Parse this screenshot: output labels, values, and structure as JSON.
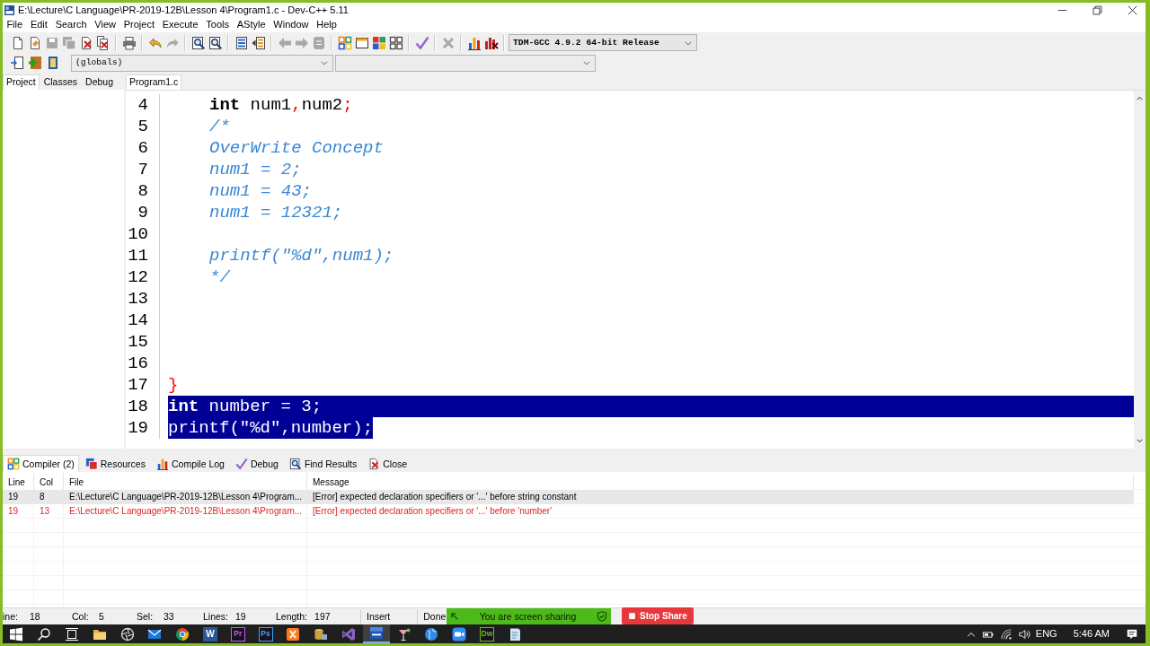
{
  "window": {
    "title": "E:\\Lecture\\C Language\\PR-2019-12B\\Lesson 4\\Program1.c - Dev-C++ 5.11"
  },
  "menu": [
    "File",
    "Edit",
    "Search",
    "View",
    "Project",
    "Execute",
    "Tools",
    "AStyle",
    "Window",
    "Help"
  ],
  "toolbar": {
    "groups": [
      [
        {
          "kind": "new",
          "disabled": false
        },
        {
          "kind": "open",
          "disabled": false
        },
        {
          "kind": "save",
          "disabled": true
        },
        {
          "kind": "saveall",
          "disabled": true
        },
        {
          "kind": "close",
          "disabled": false
        },
        {
          "kind": "closeall",
          "disabled": false
        }
      ],
      [
        {
          "kind": "print",
          "disabled": false
        }
      ],
      [
        {
          "kind": "undo",
          "disabled": false
        },
        {
          "kind": "redo",
          "disabled": true
        }
      ],
      [
        {
          "kind": "find",
          "disabled": false
        },
        {
          "kind": "replace",
          "disabled": false
        }
      ],
      [
        {
          "kind": "indent",
          "disabled": false
        },
        {
          "kind": "unindent",
          "disabled": false
        }
      ],
      [
        {
          "kind": "back",
          "disabled": true
        },
        {
          "kind": "forward",
          "disabled": true
        },
        {
          "kind": "bookmark",
          "disabled": true
        }
      ],
      [
        {
          "kind": "compile",
          "disabled": false
        },
        {
          "kind": "run",
          "disabled": false
        },
        {
          "kind": "compilerun",
          "disabled": false
        },
        {
          "kind": "rebuild",
          "disabled": false
        }
      ],
      [
        {
          "kind": "check",
          "disabled": false
        }
      ],
      [
        {
          "kind": "stop",
          "disabled": true
        }
      ],
      [
        {
          "kind": "profile",
          "disabled": false
        },
        {
          "kind": "deleteprofile",
          "disabled": false
        }
      ]
    ],
    "compiler": "TDM-GCC 4.9.2 64-bit Release"
  },
  "class_toolbar": {
    "buttons": [
      {
        "kind": "newclass"
      },
      {
        "kind": "addfile"
      },
      {
        "kind": "book"
      }
    ],
    "scope": "(globals)"
  },
  "side_tabs": [
    {
      "label": "Project",
      "selected": true
    },
    {
      "label": "Classes",
      "selected": false
    },
    {
      "label": "Debug",
      "selected": false
    }
  ],
  "editor_tabs": [
    {
      "label": "Program1.c",
      "selected": true
    }
  ],
  "editor": {
    "lines": [
      {
        "number": "4",
        "indented": true,
        "selected": false,
        "segments": [
          {
            "text": "int",
            "kind": "keyword"
          },
          {
            "text": " num1",
            "kind": "plain"
          },
          {
            "text": ",",
            "kind": "symbol"
          },
          {
            "text": "num2",
            "kind": "plain"
          },
          {
            "text": ";",
            "kind": "symbol"
          }
        ]
      },
      {
        "number": "5",
        "indented": true,
        "selected": false,
        "segments": [
          {
            "text": "/*",
            "kind": "comment"
          }
        ]
      },
      {
        "number": "6",
        "indented": true,
        "selected": false,
        "segments": [
          {
            "text": "OverWrite Concept",
            "kind": "comment"
          }
        ]
      },
      {
        "number": "7",
        "indented": true,
        "selected": false,
        "segments": [
          {
            "text": "num1 = 2;",
            "kind": "comment"
          }
        ]
      },
      {
        "number": "8",
        "indented": true,
        "selected": false,
        "segments": [
          {
            "text": "num1 = 43;",
            "kind": "comment"
          }
        ]
      },
      {
        "number": "9",
        "indented": true,
        "selected": false,
        "segments": [
          {
            "text": "num1 = 12321;",
            "kind": "comment"
          }
        ]
      },
      {
        "number": "10",
        "selected": false
      },
      {
        "number": "11",
        "indented": true,
        "selected": false,
        "segments": [
          {
            "text": "printf(\"%d\",num1);",
            "kind": "comment"
          }
        ]
      },
      {
        "number": "12",
        "indented": true,
        "selected": false,
        "segments": [
          {
            "text": "*/",
            "kind": "comment"
          }
        ]
      },
      {
        "number": "13",
        "selected": false
      },
      {
        "number": "14",
        "selected": false
      },
      {
        "number": "15",
        "selected": false
      },
      {
        "number": "16",
        "selected": false
      },
      {
        "number": "17",
        "indented": false,
        "selected": false,
        "segments": [
          {
            "text": "}",
            "kind": "symbol"
          }
        ]
      },
      {
        "number": "18",
        "indented": false,
        "selected": true,
        "segments": [
          {
            "text": "int",
            "kind": "keyword"
          },
          {
            "text": " number = 3;",
            "kind": "plain"
          }
        ]
      },
      {
        "number": "19",
        "indented": false,
        "selected": true,
        "segments": [
          {
            "text": "printf(\"%d\",number);",
            "kind": "plain"
          }
        ]
      }
    ]
  },
  "bottom_tabs": [
    {
      "label": "Compiler (2)",
      "kind": "compiler",
      "selected": true
    },
    {
      "label": "Resources",
      "kind": "resources",
      "selected": false
    },
    {
      "label": "Compile Log",
      "kind": "log",
      "selected": false
    },
    {
      "label": "Debug",
      "kind": "debug",
      "selected": false
    },
    {
      "label": "Find Results",
      "kind": "find",
      "selected": false
    },
    {
      "label": "Close",
      "kind": "close",
      "selected": false
    }
  ],
  "messages": {
    "columns": [
      "Line",
      "Col",
      "File",
      "Message"
    ],
    "rows": [
      {
        "cells": [
          "19",
          "8",
          "E:\\Lecture\\C Language\\PR-2019-12B\\Lesson 4\\Program...",
          "[Error] expected declaration specifiers or '...' before string constant"
        ],
        "selected": true
      },
      {
        "cells": [
          "19",
          "13",
          "E:\\Lecture\\C Language\\PR-2019-12B\\Lesson 4\\Program...",
          "[Error] expected declaration specifiers or '...' before 'number'"
        ],
        "selected": false
      }
    ]
  },
  "status_bar": {
    "fields": [
      {
        "label": "ine:",
        "value": "18"
      },
      {
        "label": "Col:",
        "value": "5"
      },
      {
        "label": "Sel:",
        "value": "33"
      },
      {
        "label": "Lines:",
        "value": "19"
      },
      {
        "label": "Length:",
        "value": "197"
      }
    ],
    "mode": "Insert",
    "message": "Done"
  },
  "screen_share": {
    "message": "You are screen sharing",
    "stop_button": "Stop Share"
  },
  "taskbar": {
    "items": [
      {
        "kind": "start",
        "active": false
      },
      {
        "kind": "search",
        "active": false
      },
      {
        "kind": "taskview",
        "active": false
      },
      {
        "kind": "folder",
        "active": false
      },
      {
        "kind": "aperture",
        "active": false
      },
      {
        "kind": "mail",
        "active": false
      },
      {
        "kind": "browser",
        "active": false
      },
      {
        "kind": "doc",
        "label": "W",
        "color": "#2b5797",
        "active": false
      },
      {
        "kind": "tile",
        "label": "Pr",
        "color": "#b564e6",
        "active": false
      },
      {
        "kind": "tile",
        "label": "Ps",
        "color": "#31a8ff",
        "active": false
      },
      {
        "kind": "xampp",
        "active": false
      },
      {
        "kind": "database",
        "active": false
      },
      {
        "kind": "ribbon",
        "active": false
      },
      {
        "kind": "devcpp",
        "active": true
      },
      {
        "kind": "glass",
        "active": false
      },
      {
        "kind": "globe",
        "active": false
      },
      {
        "kind": "camera",
        "active": false
      },
      {
        "kind": "tile",
        "label": "Dw",
        "color": "#5ec21a",
        "active": false
      },
      {
        "kind": "notepad",
        "active": false
      }
    ],
    "language": "ENG",
    "clock": "5:46 AM"
  }
}
